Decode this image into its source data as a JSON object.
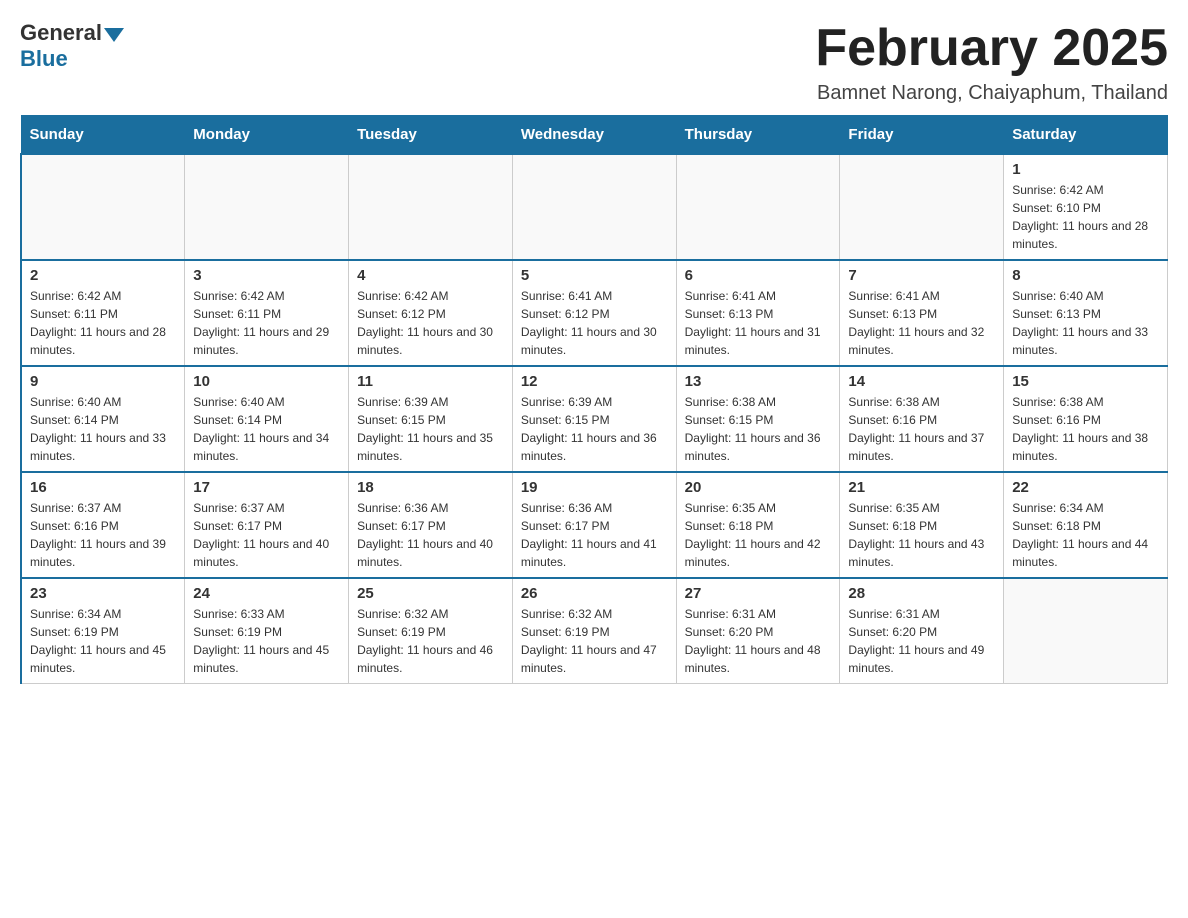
{
  "header": {
    "logo_general": "General",
    "logo_blue": "Blue",
    "title": "February 2025",
    "subtitle": "Bamnet Narong, Chaiyaphum, Thailand"
  },
  "weekdays": [
    "Sunday",
    "Monday",
    "Tuesday",
    "Wednesday",
    "Thursday",
    "Friday",
    "Saturday"
  ],
  "weeks": [
    [
      {
        "day": "",
        "info": ""
      },
      {
        "day": "",
        "info": ""
      },
      {
        "day": "",
        "info": ""
      },
      {
        "day": "",
        "info": ""
      },
      {
        "day": "",
        "info": ""
      },
      {
        "day": "",
        "info": ""
      },
      {
        "day": "1",
        "info": "Sunrise: 6:42 AM\nSunset: 6:10 PM\nDaylight: 11 hours and 28 minutes."
      }
    ],
    [
      {
        "day": "2",
        "info": "Sunrise: 6:42 AM\nSunset: 6:11 PM\nDaylight: 11 hours and 28 minutes."
      },
      {
        "day": "3",
        "info": "Sunrise: 6:42 AM\nSunset: 6:11 PM\nDaylight: 11 hours and 29 minutes."
      },
      {
        "day": "4",
        "info": "Sunrise: 6:42 AM\nSunset: 6:12 PM\nDaylight: 11 hours and 30 minutes."
      },
      {
        "day": "5",
        "info": "Sunrise: 6:41 AM\nSunset: 6:12 PM\nDaylight: 11 hours and 30 minutes."
      },
      {
        "day": "6",
        "info": "Sunrise: 6:41 AM\nSunset: 6:13 PM\nDaylight: 11 hours and 31 minutes."
      },
      {
        "day": "7",
        "info": "Sunrise: 6:41 AM\nSunset: 6:13 PM\nDaylight: 11 hours and 32 minutes."
      },
      {
        "day": "8",
        "info": "Sunrise: 6:40 AM\nSunset: 6:13 PM\nDaylight: 11 hours and 33 minutes."
      }
    ],
    [
      {
        "day": "9",
        "info": "Sunrise: 6:40 AM\nSunset: 6:14 PM\nDaylight: 11 hours and 33 minutes."
      },
      {
        "day": "10",
        "info": "Sunrise: 6:40 AM\nSunset: 6:14 PM\nDaylight: 11 hours and 34 minutes."
      },
      {
        "day": "11",
        "info": "Sunrise: 6:39 AM\nSunset: 6:15 PM\nDaylight: 11 hours and 35 minutes."
      },
      {
        "day": "12",
        "info": "Sunrise: 6:39 AM\nSunset: 6:15 PM\nDaylight: 11 hours and 36 minutes."
      },
      {
        "day": "13",
        "info": "Sunrise: 6:38 AM\nSunset: 6:15 PM\nDaylight: 11 hours and 36 minutes."
      },
      {
        "day": "14",
        "info": "Sunrise: 6:38 AM\nSunset: 6:16 PM\nDaylight: 11 hours and 37 minutes."
      },
      {
        "day": "15",
        "info": "Sunrise: 6:38 AM\nSunset: 6:16 PM\nDaylight: 11 hours and 38 minutes."
      }
    ],
    [
      {
        "day": "16",
        "info": "Sunrise: 6:37 AM\nSunset: 6:16 PM\nDaylight: 11 hours and 39 minutes."
      },
      {
        "day": "17",
        "info": "Sunrise: 6:37 AM\nSunset: 6:17 PM\nDaylight: 11 hours and 40 minutes."
      },
      {
        "day": "18",
        "info": "Sunrise: 6:36 AM\nSunset: 6:17 PM\nDaylight: 11 hours and 40 minutes."
      },
      {
        "day": "19",
        "info": "Sunrise: 6:36 AM\nSunset: 6:17 PM\nDaylight: 11 hours and 41 minutes."
      },
      {
        "day": "20",
        "info": "Sunrise: 6:35 AM\nSunset: 6:18 PM\nDaylight: 11 hours and 42 minutes."
      },
      {
        "day": "21",
        "info": "Sunrise: 6:35 AM\nSunset: 6:18 PM\nDaylight: 11 hours and 43 minutes."
      },
      {
        "day": "22",
        "info": "Sunrise: 6:34 AM\nSunset: 6:18 PM\nDaylight: 11 hours and 44 minutes."
      }
    ],
    [
      {
        "day": "23",
        "info": "Sunrise: 6:34 AM\nSunset: 6:19 PM\nDaylight: 11 hours and 45 minutes."
      },
      {
        "day": "24",
        "info": "Sunrise: 6:33 AM\nSunset: 6:19 PM\nDaylight: 11 hours and 45 minutes."
      },
      {
        "day": "25",
        "info": "Sunrise: 6:32 AM\nSunset: 6:19 PM\nDaylight: 11 hours and 46 minutes."
      },
      {
        "day": "26",
        "info": "Sunrise: 6:32 AM\nSunset: 6:19 PM\nDaylight: 11 hours and 47 minutes."
      },
      {
        "day": "27",
        "info": "Sunrise: 6:31 AM\nSunset: 6:20 PM\nDaylight: 11 hours and 48 minutes."
      },
      {
        "day": "28",
        "info": "Sunrise: 6:31 AM\nSunset: 6:20 PM\nDaylight: 11 hours and 49 minutes."
      },
      {
        "day": "",
        "info": ""
      }
    ]
  ]
}
